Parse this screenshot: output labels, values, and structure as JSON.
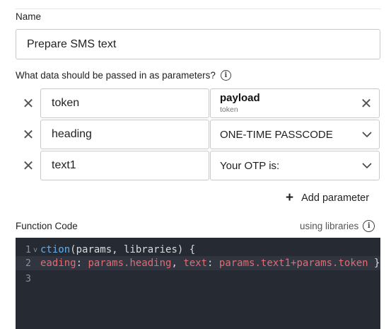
{
  "name_field": {
    "label": "Name",
    "value": "Prepare SMS text"
  },
  "parameters": {
    "label": "What data should be passed in as parameters?",
    "rows": [
      {
        "name": "token",
        "value": "payload",
        "value_sub": "token",
        "control": "clear"
      },
      {
        "name": "heading",
        "value": "ONE-TIME PASSCODE",
        "control": "dropdown"
      },
      {
        "name": "text1",
        "value": "Your OTP is:",
        "control": "dropdown"
      }
    ],
    "add_label": "Add parameter"
  },
  "function_code": {
    "label": "Function Code",
    "libraries_link": "using libraries",
    "line_numbers": [
      "1",
      "2",
      "3"
    ],
    "line1": {
      "part1": "ction",
      "part2": "(params, libraries) {"
    },
    "line2": {
      "p1": "eading",
      "p2": ": ",
      "p3": "params.heading",
      "p4": ", ",
      "p5": "text",
      "p6": ": ",
      "p7": "params.text1+params.token",
      "p8": " }"
    }
  },
  "icons": {
    "remove": "close-x-icon",
    "info": "info-circle-icon",
    "dropdown": "chevron-down-icon",
    "add": "plus-icon",
    "fold": "fold-arrow-icon"
  },
  "colors": {
    "editor_bg": "#262b33",
    "keyword": "#61afef",
    "property": "#e06c75"
  }
}
